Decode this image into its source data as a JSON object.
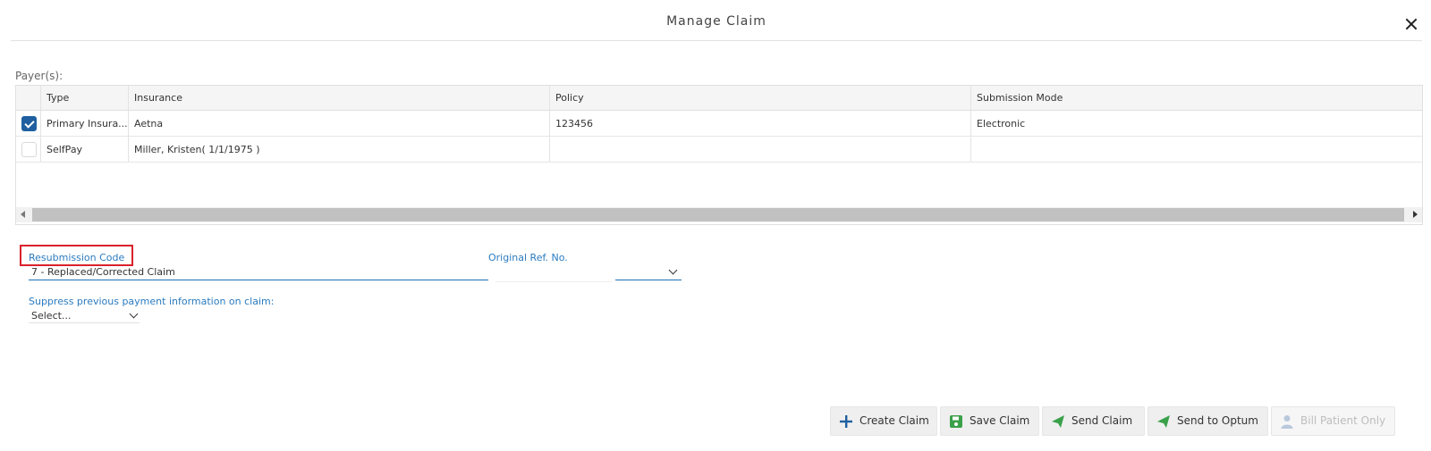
{
  "header": {
    "title": "Manage Claim"
  },
  "payers": {
    "label": "Payer(s):",
    "columns": [
      "",
      "Type",
      "Insurance",
      "Policy",
      "Submission Mode"
    ],
    "rows": [
      {
        "checked": true,
        "type": "Primary Insura...",
        "insurance": "Aetna",
        "policy": "123456",
        "mode": "Electronic"
      },
      {
        "checked": false,
        "type": "SelfPay",
        "insurance": "Miller, Kristen( 1/1/1975 )",
        "policy": "",
        "mode": ""
      }
    ]
  },
  "form": {
    "resubmission_label": "Resubmission Code",
    "resubmission_value": "7 - Replaced/Corrected Claim",
    "original_ref_label": "Original Ref. No.",
    "original_ref_value": "",
    "suppress_label": "Suppress previous payment information on claim:",
    "suppress_value": "Select..."
  },
  "buttons": {
    "create_claim": "Create Claim",
    "save_claim": "Save Claim",
    "send_claim": "Send Claim",
    "send_to_optum": "Send to Optum",
    "bill_patient_only": "Bill Patient Only"
  },
  "colors": {
    "accent": "#1f5fa0",
    "label_blue": "#2a7bc0",
    "highlight_red": "#d9212a",
    "send_green": "#3aa04a"
  },
  "icons": [
    "close-icon",
    "checkbox-checked-icon",
    "plus-icon",
    "save-icon",
    "send-icon",
    "user-icon",
    "chevron-down-icon"
  ]
}
